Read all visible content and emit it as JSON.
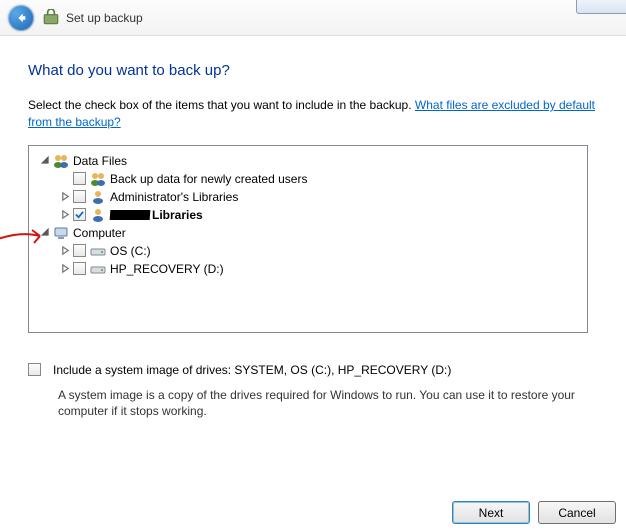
{
  "titlebar": {
    "title": "Set up backup"
  },
  "heading": "What do you want to back up?",
  "instruction_prefix": "Select the check box of the items that you want to include in the backup. ",
  "help_link": "What files are excluded by default from the backup?",
  "tree": {
    "data_files": {
      "label": "Data Files",
      "children": {
        "new_users": "Back up data for newly created users",
        "admin_libs": "Administrator's Libraries",
        "user_libs_suffix": "Libraries"
      }
    },
    "computer": {
      "label": "Computer",
      "children": {
        "os_c": "OS (C:)",
        "hp_recovery": "HP_RECOVERY (D:)"
      }
    }
  },
  "system_image": {
    "label": "Include a system image of drives: SYSTEM, OS (C:), HP_RECOVERY (D:)",
    "description": "A system image is a copy of the drives required for Windows to run. You can use it to restore your computer if it stops working."
  },
  "buttons": {
    "next": "Next",
    "cancel": "Cancel"
  }
}
